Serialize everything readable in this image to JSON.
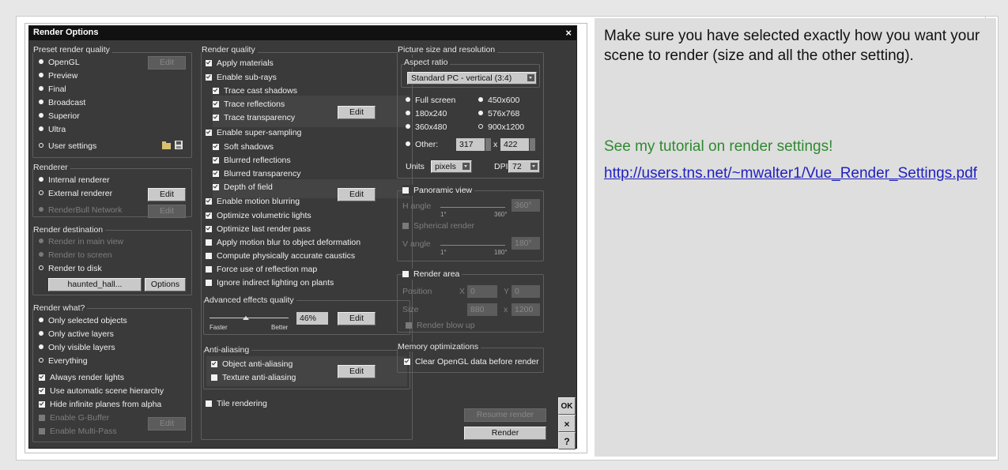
{
  "dialog": {
    "title": "Render Options",
    "close_glyph": "×",
    "preset": {
      "title": "Preset render quality",
      "items": [
        "OpenGL",
        "Preview",
        "Final",
        "Broadcast",
        "Superior",
        "Ultra"
      ],
      "user_settings": "User settings",
      "edit": "Edit"
    },
    "renderer": {
      "title": "Renderer",
      "internal": "Internal renderer",
      "external": "External renderer",
      "renderbull": "RenderBull Network",
      "edit": "Edit"
    },
    "destination": {
      "title": "Render destination",
      "main_view": "Render in main view",
      "screen": "Render to screen",
      "disk": "Render to disk",
      "file": "haunted_hall...",
      "options": "Options"
    },
    "what": {
      "title": "Render what?",
      "selected": "Only selected objects",
      "active": "Only active layers",
      "visible": "Only visible layers",
      "everything": "Everything",
      "lights": "Always render lights",
      "hierarchy": "Use automatic scene hierarchy",
      "infinite": "Hide infinite planes from alpha",
      "gbuffer": "Enable G-Buffer",
      "multipass": "Enable Multi-Pass",
      "edit": "Edit"
    },
    "quality": {
      "title": "Render quality",
      "apply_materials": "Apply materials",
      "subrays": "Enable sub-rays",
      "cast_shadows": "Trace cast shadows",
      "reflections": "Trace reflections",
      "transparency": "Trace transparency",
      "supersampling": "Enable super-sampling",
      "soft_shadows": "Soft shadows",
      "blurred_reflections": "Blurred reflections",
      "blurred_transparency": "Blurred transparency",
      "dof": "Depth of field",
      "motion_blur": "Enable motion blurring",
      "volumetric": "Optimize volumetric lights",
      "last_pass": "Optimize last render pass",
      "motion_deform": "Apply motion blur to object deformation",
      "caustics": "Compute physically accurate caustics",
      "reflection_map": "Force use of reflection map",
      "indirect": "Ignore indirect lighting on plants",
      "edit": "Edit"
    },
    "advanced": {
      "title": "Advanced effects quality",
      "faster": "Faster",
      "better": "Better",
      "value": "46%",
      "value_fraction": 0.46,
      "edit": "Edit"
    },
    "antialias": {
      "title": "Anti-aliasing",
      "object": "Object anti-aliasing",
      "texture": "Texture anti-aliasing",
      "edit": "Edit"
    },
    "tile": "Tile rendering",
    "picture": {
      "title": "Picture size and resolution",
      "aspect_title": "Aspect ratio",
      "aspect_value": "Standard PC - vertical (3:4)",
      "full_screen": "Full screen",
      "r450": "450x600",
      "r180": "180x240",
      "r576": "576x768",
      "r360": "360x480",
      "r900": "900x1200",
      "other": "Other:",
      "w": "317",
      "times": "x",
      "h": "422",
      "units_label": "Units",
      "units": "pixels",
      "dpi_label": "DPI",
      "dpi": "72"
    },
    "panoramic": {
      "title": "Panoramic view",
      "h_angle": "H angle",
      "h_value": "360°",
      "h_min": "1°",
      "h_max": "360°",
      "spherical": "Spherical render",
      "v_angle": "V angle",
      "v_value": "180°",
      "v_min": "1°",
      "v_max": "180°"
    },
    "area": {
      "title": "Render area",
      "position": "Position",
      "x_label": "X",
      "x": "0",
      "y_label": "Y",
      "y": "0",
      "size": "Size",
      "w": "880",
      "times": "x",
      "h": "1200",
      "blowup": "Render blow up"
    },
    "memory": {
      "title": "Memory optimizations",
      "clear": "Clear OpenGL data before render"
    },
    "resume": "Resume render",
    "render": "Render",
    "ok": "OK",
    "cancel": "×",
    "help": "?"
  },
  "panel": {
    "text": "Make sure you have selected exactly how you want your scene to render (size and all the other setting).",
    "note": "See my tutorial on render settings!",
    "link": "http://users.tns.net/~mwalter1/Vue_Render_Settings.pdf"
  },
  "colors": {
    "dialog_bg": "#3a3a3a",
    "title_bg": "#111111",
    "note_green": "#2f8a2f",
    "link_blue": "#1f1fc0"
  }
}
